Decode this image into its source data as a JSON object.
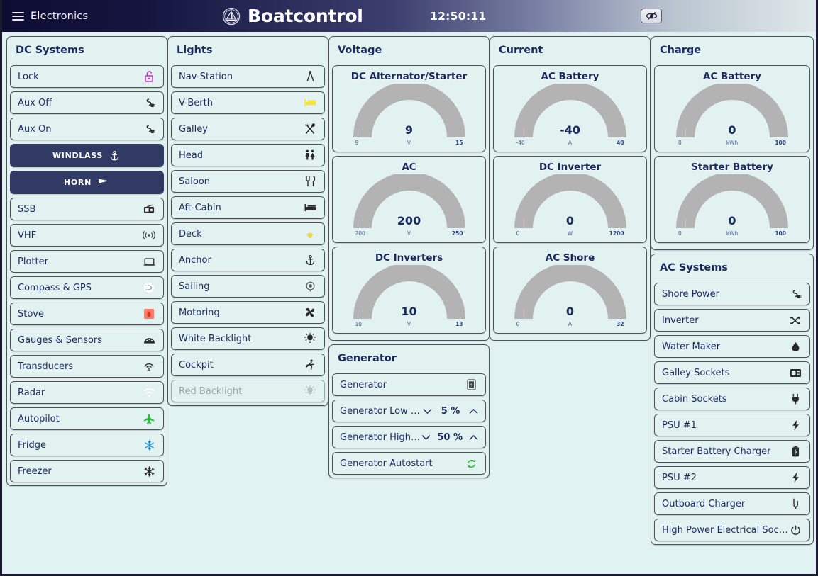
{
  "header": {
    "menu_label": "Electronics",
    "menu_icon": "hamburger-icon",
    "brand_title": "Boatcontrol",
    "brand_icon": "sailboat-logo-icon",
    "clock": "12:50:11",
    "eye_button_icon": "eye-slash-icon"
  },
  "colors": {
    "background": "#e0f2f1",
    "panel_bg": "#e2f2f1",
    "border": "#4b5358",
    "text_primary": "#1b2a5e",
    "action_bg": "#303a64",
    "accent_green": "#22c233",
    "accent_magenta": "#cc22cc",
    "disabled_text": "#9aa4aa"
  },
  "dc_systems": {
    "title": "DC Systems",
    "items": [
      {
        "label": "Lock",
        "icon": "open-lock-icon",
        "style": "normal",
        "state": "on"
      },
      {
        "label": "Aux Off",
        "icon": "power-plug-off-icon",
        "style": "normal",
        "state": "off"
      },
      {
        "label": "Aux On",
        "icon": "power-plug-on-icon",
        "style": "normal",
        "state": "off"
      },
      {
        "label": "WINDLASS",
        "icon": "anchor-icon",
        "style": "action",
        "state": "off"
      },
      {
        "label": "HORN",
        "icon": "horn-icon",
        "style": "action",
        "state": "off"
      },
      {
        "label": "SSB",
        "icon": "radio-icon",
        "style": "normal",
        "state": "off"
      },
      {
        "label": "VHF",
        "icon": "broadcast-icon",
        "style": "normal",
        "state": "off"
      },
      {
        "label": "Plotter",
        "icon": "screen-icon",
        "style": "normal",
        "state": "off"
      },
      {
        "label": "Compass & GPS",
        "icon": "globe-icon",
        "style": "normal",
        "state": "off"
      },
      {
        "label": "Stove",
        "icon": "stove-icon",
        "style": "normal",
        "state": "on"
      },
      {
        "label": "Gauges & Sensors",
        "icon": "gauge-icon",
        "style": "normal",
        "state": "off"
      },
      {
        "label": "Transducers",
        "icon": "sonar-icon",
        "style": "normal",
        "state": "off"
      },
      {
        "label": "Radar",
        "icon": "radar-icon",
        "style": "normal",
        "state": "off"
      },
      {
        "label": "Autopilot",
        "icon": "autopilot-plane-icon",
        "style": "normal",
        "state": "on"
      },
      {
        "label": "Fridge",
        "icon": "snowflake-blue-icon",
        "style": "normal",
        "state": "on"
      },
      {
        "label": "Freezer",
        "icon": "snowflake-icon",
        "style": "normal",
        "state": "off"
      }
    ]
  },
  "lights": {
    "title": "Lights",
    "items": [
      {
        "label": "Nav-Station",
        "icon": "dividers-icon",
        "state": "off"
      },
      {
        "label": "V-Berth",
        "icon": "bed-icon",
        "state": "on"
      },
      {
        "label": "Galley",
        "icon": "fork-spoon-icon",
        "state": "off"
      },
      {
        "label": "Head",
        "icon": "restroom-icon",
        "state": "off"
      },
      {
        "label": "Saloon",
        "icon": "cutlery-icon",
        "state": "off"
      },
      {
        "label": "Aft-Cabin",
        "icon": "bed-icon",
        "state": "off"
      },
      {
        "label": "Deck",
        "icon": "deck-light-icon",
        "state": "on"
      },
      {
        "label": "Anchor",
        "icon": "anchor-icon",
        "state": "off"
      },
      {
        "label": "Sailing",
        "icon": "mast-light-icon",
        "state": "off"
      },
      {
        "label": "Motoring",
        "icon": "propeller-icon",
        "state": "off"
      },
      {
        "label": "White Backlight",
        "icon": "bulb-icon",
        "state": "off"
      },
      {
        "label": "Cockpit",
        "icon": "cockpit-icon",
        "state": "off"
      },
      {
        "label": "Red Backlight",
        "icon": "bulb-icon",
        "state": "disabled"
      }
    ]
  },
  "voltage": {
    "title": "Voltage",
    "gauges": [
      {
        "title": "DC Alternator/Starter",
        "value": "9",
        "unit": "V",
        "min": "9",
        "max": "15"
      },
      {
        "title": "AC",
        "value": "200",
        "unit": "V",
        "min": "200",
        "max": "250"
      },
      {
        "title": "DC Inverters",
        "value": "10",
        "unit": "V",
        "min": "10",
        "max": "13"
      }
    ]
  },
  "generator": {
    "title": "Generator",
    "items": [
      {
        "label": "Generator",
        "type": "toggle",
        "icon": "generator-icon"
      },
      {
        "label": "Generator Low Mark",
        "type": "stepper",
        "value": "5 %",
        "icon": "chevron-stepper-icon"
      },
      {
        "label": "Generator High Mark",
        "type": "stepper",
        "value": "50 %",
        "icon": "chevron-stepper-icon"
      },
      {
        "label": "Generator Autostart",
        "type": "toggle",
        "icon": "autostart-refresh-icon"
      }
    ]
  },
  "current": {
    "title": "Current",
    "gauges": [
      {
        "title": "AC Battery",
        "value": "-40",
        "unit": "A",
        "min": "-40",
        "max": "40"
      },
      {
        "title": "DC Inverter",
        "value": "0",
        "unit": "W",
        "min": "0",
        "max": "1200"
      },
      {
        "title": "AC Shore",
        "value": "0",
        "unit": "A",
        "min": "0",
        "max": "32"
      }
    ]
  },
  "charge": {
    "title": "Charge",
    "gauges": [
      {
        "title": "AC Battery",
        "value": "0",
        "unit": "kWh",
        "min": "0",
        "max": "100"
      },
      {
        "title": "Starter Battery",
        "value": "0",
        "unit": "kWh",
        "min": "0",
        "max": "100"
      }
    ]
  },
  "ac_systems": {
    "title": "AC Systems",
    "items": [
      {
        "label": "Shore Power",
        "icon": "power-plug-on-icon"
      },
      {
        "label": "Inverter",
        "icon": "shuffle-icon"
      },
      {
        "label": "Water Maker",
        "icon": "water-drop-icon"
      },
      {
        "label": "Galley Sockets",
        "icon": "socket-panel-icon"
      },
      {
        "label": "Cabin Sockets",
        "icon": "plug-icon"
      },
      {
        "label": "PSU #1",
        "icon": "bolt-icon"
      },
      {
        "label": "Starter Battery Charger",
        "icon": "battery-icon"
      },
      {
        "label": "PSU #2",
        "icon": "bolt-icon"
      },
      {
        "label": "Outboard Charger",
        "icon": "outboard-icon"
      },
      {
        "label": "High Power Electrical Sockets",
        "icon": "power-icon"
      }
    ]
  }
}
